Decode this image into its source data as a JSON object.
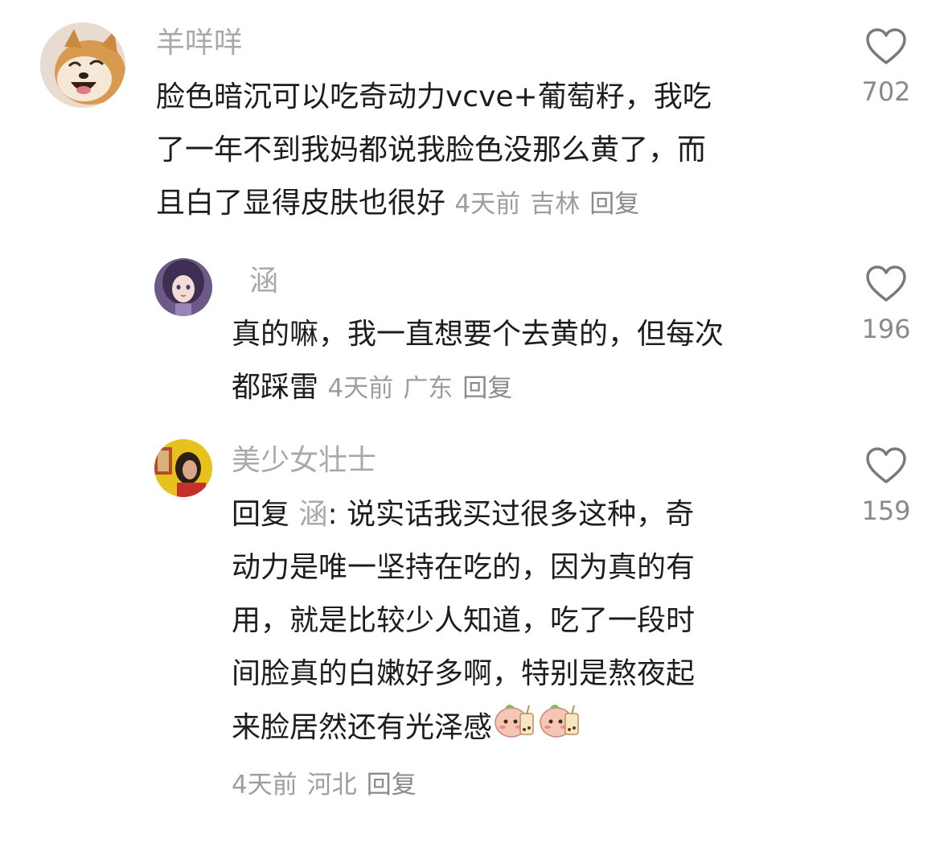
{
  "comments": [
    {
      "username": "羊咩咩",
      "lines": [
        "脸色暗沉可以吃奇动力vcve+葡萄籽，我吃",
        "了一年不到我妈都说我脸色没那么黄了，而",
        "且白了显得皮肤也很好"
      ],
      "time": "4天前",
      "location": "吉林",
      "reply_label": "回复",
      "likes": "702",
      "avatar": "shiba-dog-avatar"
    },
    {
      "username": "涵",
      "lines": [
        "真的嘛，我一直想要个去黄的，但每次",
        "都踩雷"
      ],
      "time": "4天前",
      "location": "广东",
      "reply_label": "回复",
      "likes": "196",
      "avatar": "anime-girl-avatar"
    },
    {
      "username": "美少女壮士",
      "reply_prefix": "回复",
      "reply_to": "涵",
      "reply_colon": ":",
      "lines": [
        "说实话我买过很多这种，奇",
        "动力是唯一坚持在吃的，因为真的有",
        "用，就是比较少人知道，吃了一段时",
        "间脸真的白嫩好多啊，特别是熬夜起",
        "来脸居然还有光泽感"
      ],
      "time": "4天前",
      "location": "河北",
      "reply_label": "回复",
      "likes": "159",
      "avatar": "girl-photo-avatar",
      "emojis": [
        "peach-bubble-tea-emoji",
        "peach-bubble-tea-emoji"
      ]
    }
  ],
  "colors": {
    "text": "#1d1d1d",
    "username": "#a9a9a9",
    "meta": "#9d9d9d",
    "like_icon": "#7a7a7a"
  }
}
